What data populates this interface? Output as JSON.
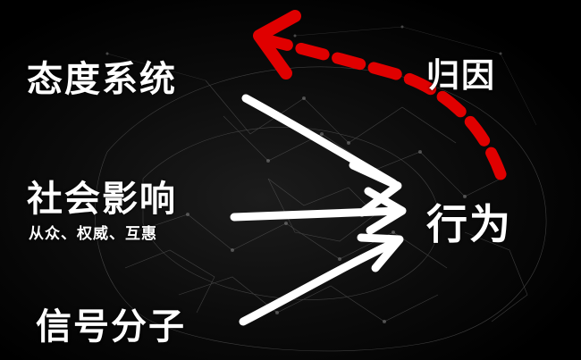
{
  "labels": {
    "attitude": "态度系统",
    "social_influence": "社会影响",
    "social_influence_sub": "从众、权威、互惠",
    "signal_molecule": "信号分子",
    "attribution": "归因",
    "behavior": "行为"
  },
  "colors": {
    "background": "#000000",
    "text": "#ffffff",
    "arrow_white": "#ffffff",
    "arrow_red": "#e00000"
  }
}
